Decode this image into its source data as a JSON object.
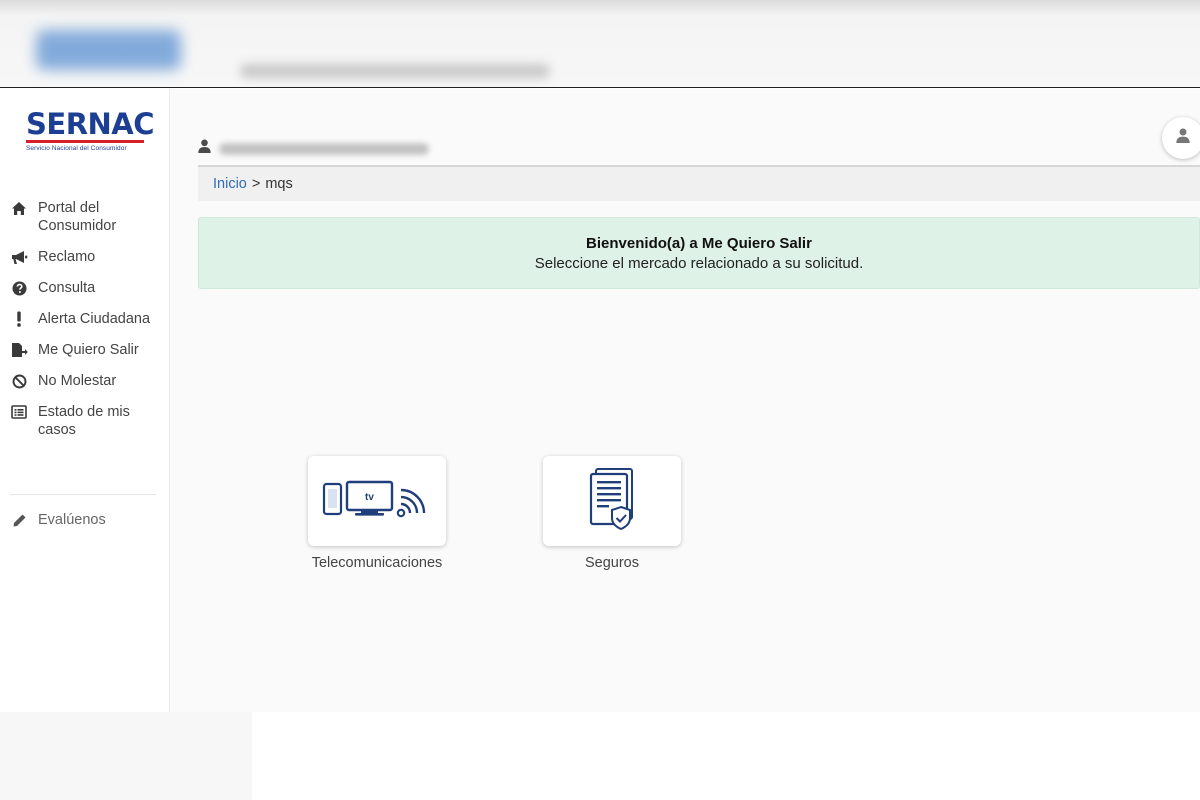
{
  "brand": {
    "name": "SERNAC",
    "subtitle": "Servicio Nacional del Consumidor"
  },
  "sidebar": {
    "items": [
      {
        "label": "Portal del Consumidor",
        "icon": "home-icon"
      },
      {
        "label": "Reclamo",
        "icon": "megaphone-icon"
      },
      {
        "label": "Consulta",
        "icon": "question-circle-icon"
      },
      {
        "label": "Alerta Ciudadana",
        "icon": "exclamation-icon"
      },
      {
        "label": "Me Quiero Salir",
        "icon": "exit-document-icon"
      },
      {
        "label": "No Molestar",
        "icon": "ban-icon"
      },
      {
        "label": "Estado de mis casos",
        "icon": "list-icon"
      }
    ],
    "evaluate": {
      "label": "Evalúenos",
      "icon": "pencil-icon"
    }
  },
  "breadcrumb": {
    "home": "Inicio",
    "separator": ">",
    "current": "mqs"
  },
  "welcome": {
    "title": "Bienvenido(a) a Me Quiero Salir",
    "subtitle": "Seleccione el mercado relacionado a su solicitud."
  },
  "markets": [
    {
      "label": "Telecomunicaciones",
      "icon": "telecom-devices-icon",
      "tv_text": "tv"
    },
    {
      "label": "Seguros",
      "icon": "insurance-document-icon"
    }
  ],
  "colors": {
    "brand_blue": "#1c3f94",
    "brand_red": "#d5202b",
    "link": "#2f6db8",
    "welcome_bg": "#dff2e7",
    "icon_navy": "#1f3e7a"
  }
}
